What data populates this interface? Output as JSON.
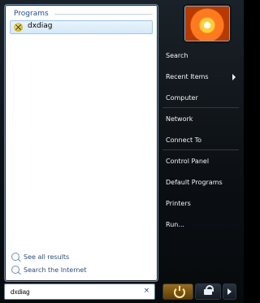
{
  "left": {
    "group_title": "Programs",
    "result": {
      "label": "dxdiag"
    },
    "links": [
      {
        "label": "See all results"
      },
      {
        "label": "Search the Internet"
      }
    ],
    "search": {
      "value": "dxdiag"
    }
  },
  "right": {
    "items": [
      {
        "label": "Search"
      },
      {
        "label": "Recent Items"
      },
      {
        "label": "Computer"
      },
      {
        "label": "Network"
      },
      {
        "label": "Connect To"
      },
      {
        "label": "Control Panel"
      },
      {
        "label": "Default Programs"
      },
      {
        "label": "Printers"
      },
      {
        "label": "Run..."
      }
    ]
  },
  "icons": {
    "result_icon": "dxdiag-icon",
    "search_link_icon": "search-icon",
    "clear_icon": "close-icon",
    "avatar": "avatar",
    "power_icon": "power-icon",
    "lock_icon": "lock-icon",
    "more_icon": "chevron-right-icon",
    "submenu_icon": "submenu-arrow-icon"
  }
}
